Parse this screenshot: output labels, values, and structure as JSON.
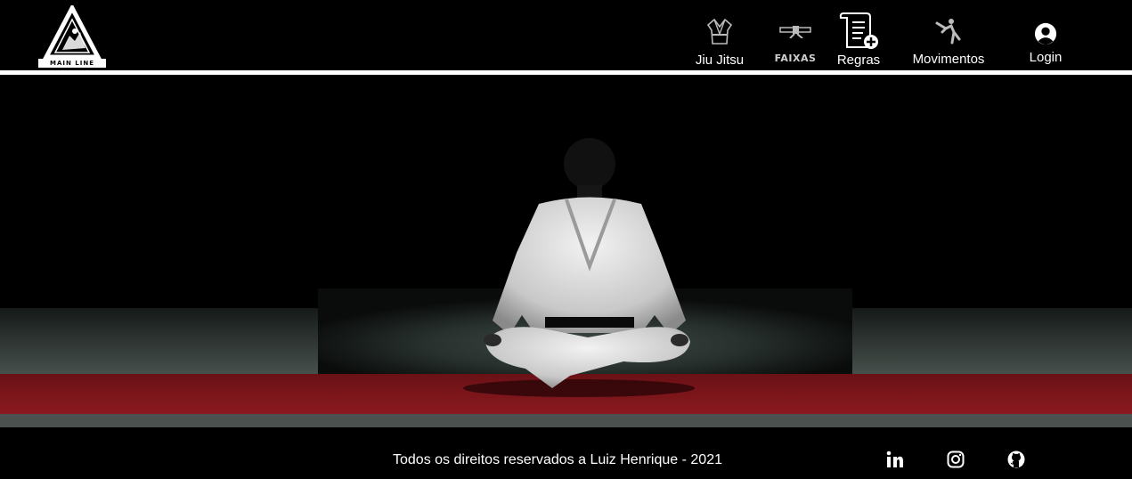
{
  "brand": {
    "logo_text": "MAIN LINE"
  },
  "nav": {
    "items": [
      {
        "label": "Jiu Jitsu",
        "icon": "gi-kimono-icon"
      },
      {
        "label": "FAIXAS",
        "icon": "belt-icon"
      },
      {
        "label": "Regras",
        "icon": "rules-document-icon"
      },
      {
        "label": "Movimentos",
        "icon": "fighter-kick-icon"
      },
      {
        "label": "Login",
        "icon": "user-avatar-icon"
      }
    ]
  },
  "hero": {
    "image": "judoka-seated-meditation-photo"
  },
  "footer": {
    "copyright": "Todos os direitos reservados a Luiz Henrique - 2021",
    "social": [
      {
        "icon": "linkedin-icon"
      },
      {
        "icon": "instagram-icon"
      },
      {
        "icon": "github-icon"
      }
    ]
  },
  "colors": {
    "background": "#000000",
    "text": "#ffffff",
    "mat_red": "#7a1218",
    "mat_gray": "#3c4440"
  }
}
